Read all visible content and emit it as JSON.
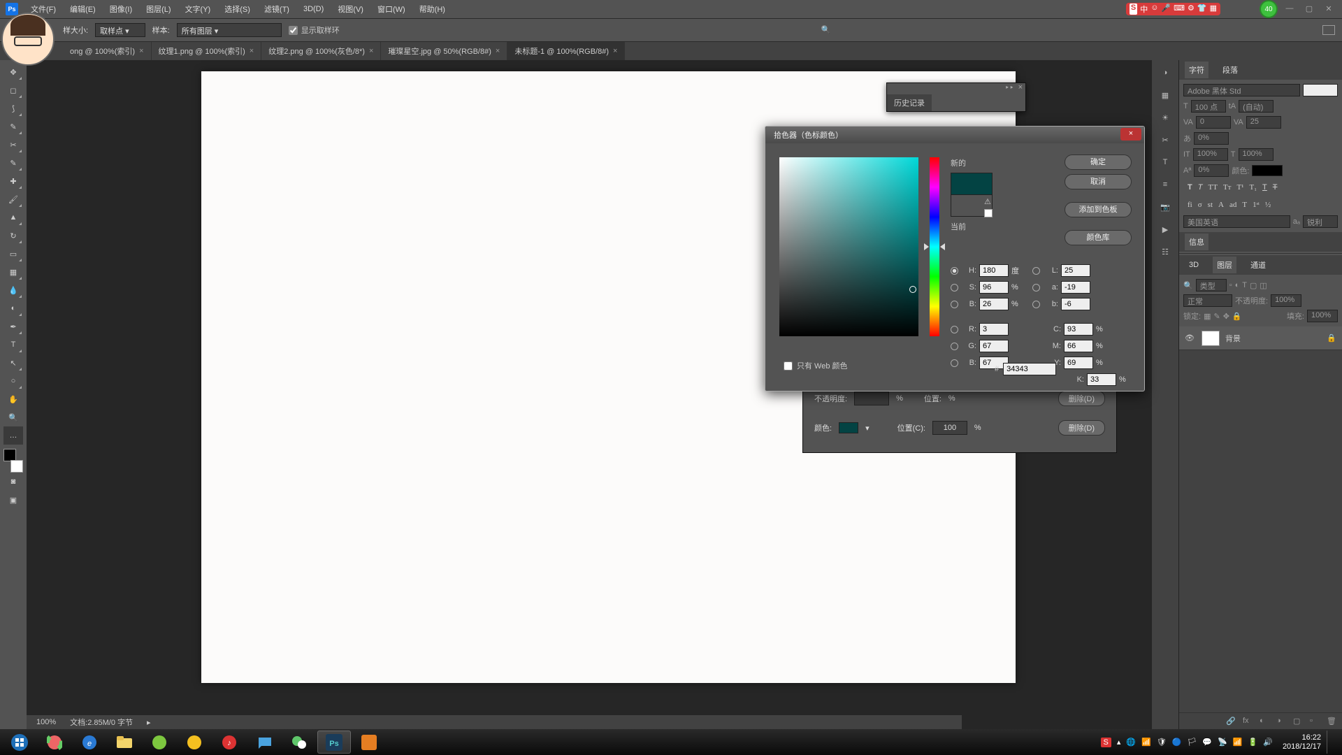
{
  "menu": [
    "文件(F)",
    "编辑(E)",
    "图像(I)",
    "图层(L)",
    "文字(Y)",
    "选择(S)",
    "滤镜(T)",
    "3D(D)",
    "视图(V)",
    "窗口(W)",
    "帮助(H)"
  ],
  "ime": {
    "badge": "S",
    "lang": "中"
  },
  "green_badge": "40",
  "options": {
    "sample_size_label": "样大小:",
    "sample_size_value": "取样点",
    "sample_label": "样本:",
    "sample_value": "所有图层",
    "show_ring_label": "显示取样环"
  },
  "tabs": [
    {
      "label": "ong @ 100%(索引)",
      "active": false
    },
    {
      "label": "纹理1.png @ 100%(索引)",
      "active": false
    },
    {
      "label": "纹理2.png @ 100%(灰色/8*)",
      "active": false
    },
    {
      "label": "璀璨星空.jpg @ 50%(RGB/8#)",
      "active": false
    },
    {
      "label": "未标题-1 @ 100%(RGB/8#)",
      "active": true
    }
  ],
  "character_panel": {
    "tab1": "字符",
    "tab2": "段落",
    "font_family": "Adobe 黑体 Std",
    "size": "100 点",
    "leading": "(自动)",
    "tracking": "0",
    "kerning": "25",
    "vscale": "0%",
    "baseline": "0%",
    "height": "100%",
    "width": "100%",
    "color_label": "颜色:",
    "lang": "美国英语",
    "aa": "锐利"
  },
  "info_tab": "信息",
  "layers_panel": {
    "tab_3d": "3D",
    "tab_layers": "图层",
    "tab_channels": "通道",
    "kind": "类型",
    "mode": "正常",
    "opacity_label": "不透明度:",
    "opacity": "100%",
    "lock_label": "锁定:",
    "fill_label": "填充:",
    "fill": "100%",
    "layer_name": "背景"
  },
  "history_tab": "历史记录",
  "grad": {
    "opacity_label": "不透明度:",
    "opacity_unit": "%",
    "pos_label": "位置:",
    "delete_top": "删除(D)",
    "color_label": "颜色:",
    "location_label": "位置(C):",
    "location_value": "100",
    "location_unit": "%",
    "delete": "删除(D)"
  },
  "picker": {
    "title": "拾色器（色标颜色）",
    "new_label": "新的",
    "current_label": "当前",
    "ok": "确定",
    "cancel": "取消",
    "add": "添加到色板",
    "lib": "颜色库",
    "H": "180",
    "H_unit": "度",
    "S": "96",
    "B": "26",
    "R": "3",
    "G": "67",
    "Bb": "67",
    "L": "25",
    "a": "-19",
    "b": "-6",
    "C": "93",
    "M": "66",
    "Y": "69",
    "K": "33",
    "hex": "34343",
    "web_only": "只有 Web 颜色",
    "new_color": "#034343",
    "current_color": "#535353"
  },
  "status": {
    "zoom": "100%",
    "doc": "文档:2.85M/0 字节"
  },
  "clock": {
    "time": "16:22",
    "date": "2018/12/17"
  }
}
